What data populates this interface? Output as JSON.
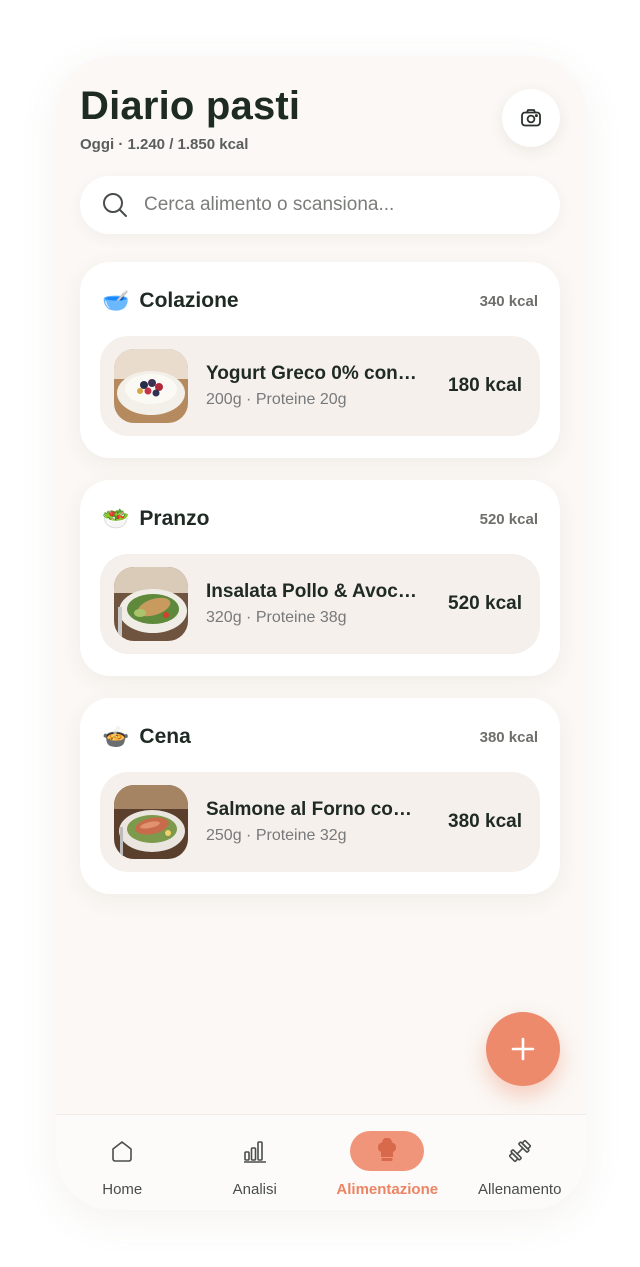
{
  "header": {
    "title": "Diario pasti",
    "subtitle": "Oggi · 1.240 / 1.850 kcal"
  },
  "search": {
    "placeholder": "Cerca alimento o scansiona..."
  },
  "meals": [
    {
      "name": "Colazione",
      "emoji": "🥣",
      "total_kcal": "340 kcal",
      "item": {
        "name": "Yogurt Greco 0% con ...",
        "details": "200g · Proteine 20g",
        "kcal": "180 kcal"
      }
    },
    {
      "name": "Pranzo",
      "emoji": "🥗",
      "total_kcal": "520 kcal",
      "item": {
        "name": "Insalata Pollo & Avocado",
        "details": "320g · Proteine 38g",
        "kcal": "520 kcal"
      }
    },
    {
      "name": "Cena",
      "emoji": "🍲",
      "total_kcal": "380 kcal",
      "item": {
        "name": "Salmone al Forno con ...",
        "details": "250g · Proteine 32g",
        "kcal": "380 kcal"
      }
    }
  ],
  "nav": {
    "items": [
      {
        "label": "Home",
        "icon": "home-icon"
      },
      {
        "label": "Analisi",
        "icon": "bar-chart-icon"
      },
      {
        "label": "Alimentazione",
        "icon": "chef-hat-icon",
        "active": true
      },
      {
        "label": "Allenamento",
        "icon": "dumbbell-icon"
      }
    ]
  },
  "colors": {
    "accent": "#ee8a6c",
    "background": "#fbf8f5",
    "item_background": "#f6f0ec",
    "text": "#1f2a24"
  }
}
